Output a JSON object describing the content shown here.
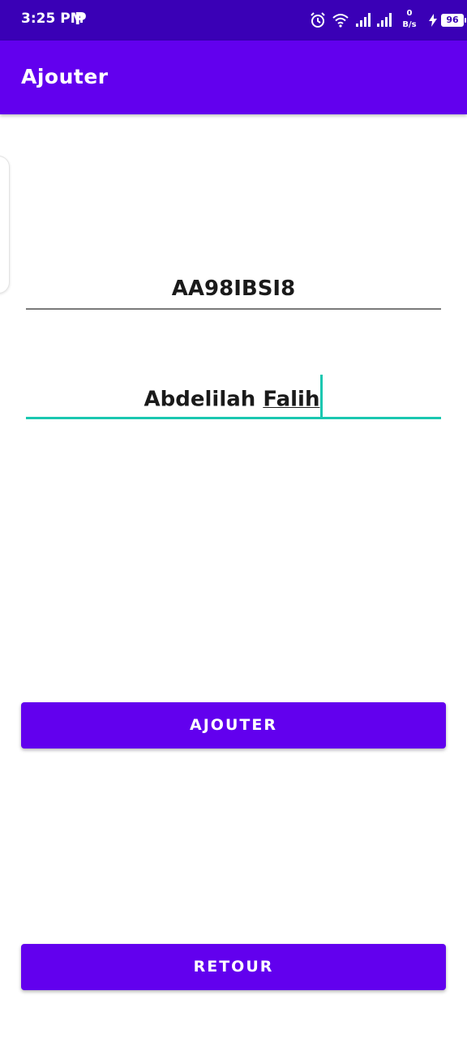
{
  "status_bar": {
    "time": "3:25 PM",
    "app_indicator": "P",
    "net_speed_value": "0",
    "net_speed_unit": "B/s",
    "battery": "96",
    "icons": [
      "alarm-icon",
      "wifi-icon",
      "signal-icon",
      "signal-icon",
      "charging-icon",
      "battery-icon"
    ]
  },
  "app_bar": {
    "title": "Ajouter"
  },
  "form": {
    "matricule_value": "AA98IBSI8",
    "nom_value_part1": "Abdelilah ",
    "nom_value_part2": "Falih"
  },
  "buttons": {
    "ajouter_label": "AJOUTER",
    "retour_label": "RETOUR"
  },
  "colors": {
    "status_bar": "#3a00b6",
    "primary": "#6200ee",
    "focus_accent": "#1ac7b0"
  }
}
